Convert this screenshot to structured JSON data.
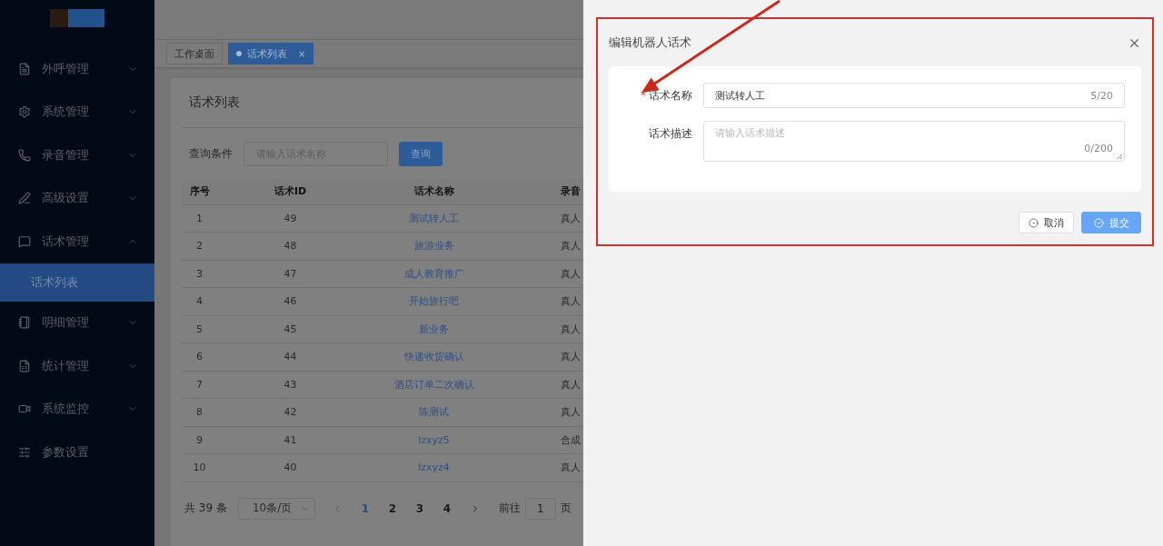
{
  "sidebar": {
    "items": [
      {
        "label": "外呼管理",
        "expanded": false,
        "selected": false
      },
      {
        "label": "系统管理",
        "expanded": false,
        "selected": false
      },
      {
        "label": "录音管理",
        "expanded": false,
        "selected": false
      },
      {
        "label": "高级设置",
        "expanded": false,
        "selected": false
      },
      {
        "label": "话术管理",
        "expanded": true,
        "selected": false,
        "children": [
          {
            "label": "话术列表",
            "selected": true
          }
        ]
      },
      {
        "label": "明细管理",
        "expanded": false,
        "selected": false
      },
      {
        "label": "统计管理",
        "expanded": false,
        "selected": false
      },
      {
        "label": "系统监控",
        "expanded": false,
        "selected": false
      },
      {
        "label": "参数设置",
        "selected": false
      }
    ]
  },
  "tabs": [
    {
      "label": "工作桌面",
      "selected": false
    },
    {
      "label": "话术列表",
      "selected": true,
      "close": "×"
    }
  ],
  "card": {
    "title": "话术列表",
    "query_label": "查询条件",
    "query_placeholder": "请输入话术名称",
    "query_button": "查询"
  },
  "table": {
    "columns": [
      "序号",
      "话术ID",
      "话术名称",
      "录音"
    ],
    "rows": [
      [
        "1",
        "49",
        "测试转人工",
        "真人"
      ],
      [
        "2",
        "48",
        "旅游业务",
        "真人"
      ],
      [
        "3",
        "47",
        "成人教育推广",
        "真人"
      ],
      [
        "4",
        "46",
        "开始旅行吧",
        "真人"
      ],
      [
        "5",
        "45",
        "新业务",
        "真人"
      ],
      [
        "6",
        "44",
        "快递收货确认",
        "真人"
      ],
      [
        "7",
        "43",
        "酒店订单二次确认",
        "真人"
      ],
      [
        "8",
        "42",
        "陈测试",
        "真人"
      ],
      [
        "9",
        "41",
        "lzxyz5",
        "合成"
      ],
      [
        "10",
        "40",
        "lzxyz4",
        "真人"
      ]
    ]
  },
  "pagination": {
    "total": "共 39 条",
    "page_size": "10条/页",
    "pages": [
      {
        "label": "1",
        "selected": true
      },
      {
        "label": "2",
        "selected": false
      },
      {
        "label": "3",
        "selected": false
      },
      {
        "label": "4",
        "selected": false
      }
    ],
    "goto_label": "前往",
    "goto_value": "1",
    "goto_suffix": "页"
  },
  "drawer": {
    "title": "编辑机器人话术",
    "fields": [
      {
        "kind": "input",
        "label": "话术名称",
        "required_mark": "*",
        "value": "测试转人工",
        "count": "5/20"
      },
      {
        "kind": "textarea",
        "label": "话术描述",
        "placeholder": "请输入话术描述",
        "count": "0/200"
      }
    ],
    "buttons": [
      {
        "label": "取消",
        "kind": "default"
      },
      {
        "label": "提交",
        "kind": "primary"
      }
    ]
  }
}
